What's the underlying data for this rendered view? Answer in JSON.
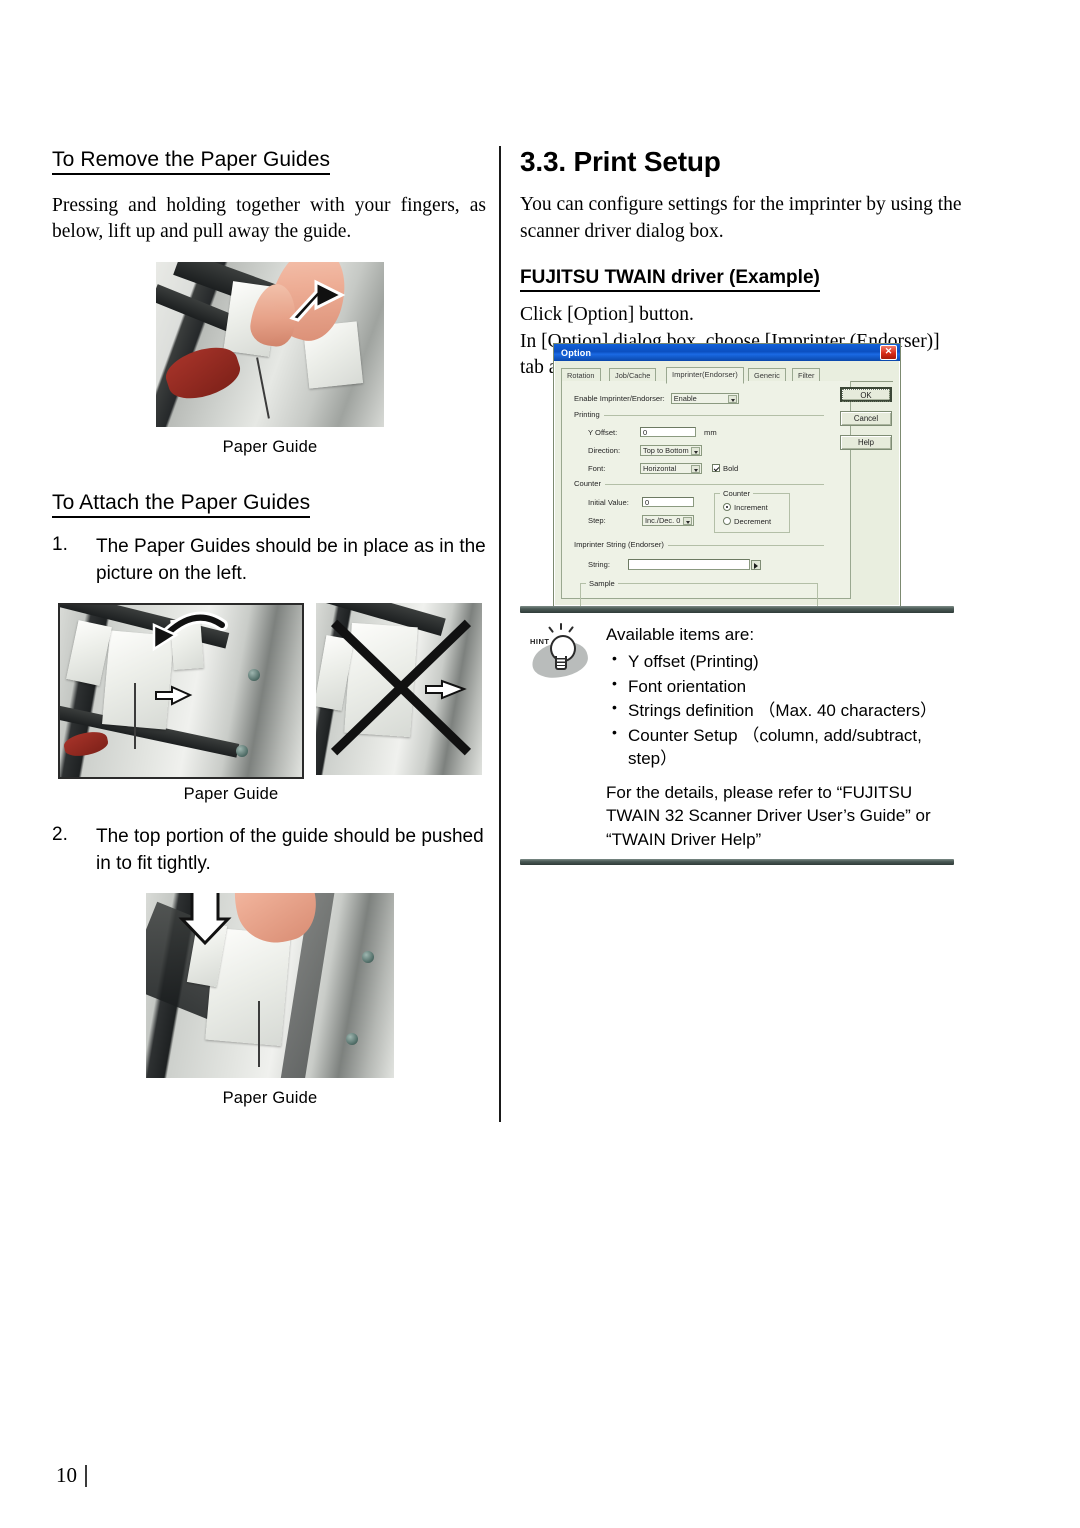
{
  "document": {
    "page_number": "10"
  },
  "left_column": {
    "remove_section": {
      "heading": "To Remove the Paper Guides",
      "body": "Pressing and holding together with your fingers, as below, lift up and pull away the guide.",
      "figure_caption": "Paper Guide"
    },
    "attach_section": {
      "heading": "To Attach the Paper Guides",
      "steps": [
        {
          "number": "1.",
          "text": "The Paper Guides should be in place as in the picture on the left."
        },
        {
          "number": "2.",
          "text": "The top portion of the guide should be pushed in to fit tightly."
        }
      ],
      "figure1_caption": "Paper Guide",
      "figure2_caption": "Paper Guide"
    }
  },
  "right_column": {
    "chapter_title": "3.3. Print Setup",
    "intro": "You can configure settings for the imprinter by using the scanner driver dialog box.",
    "subheading": "FUJITSU TWAIN driver (Example)",
    "instructions_line1": "Click [Option] button.",
    "instructions_line2": "In [Option] dialog box, choose [Imprinter (Endorser)] tab and specify the Imprinter settings."
  },
  "dialog": {
    "title": "Option",
    "close_label": "✕",
    "tabs": [
      {
        "label": "Rotation",
        "active": false
      },
      {
        "label": "Job/Cache",
        "active": false
      },
      {
        "label": "Imprinter(Endorser)",
        "active": true
      },
      {
        "label": "Generic",
        "active": false
      },
      {
        "label": "Filter",
        "active": false
      }
    ],
    "enable_label": "Enable Imprinter/Endorser:",
    "enable_value": "Enable",
    "printing_group": {
      "legend": "Printing",
      "y_offset_label": "Y Offset:",
      "y_offset_value": "0",
      "y_offset_unit": "mm",
      "direction_label": "Direction:",
      "direction_value": "Top to Bottom",
      "font_label": "Font:",
      "font_value": "Horizontal",
      "bold_label": "Bold",
      "bold_checked": true
    },
    "counter_group": {
      "legend": "Counter",
      "initial_value_label": "Initial Value:",
      "initial_value": "0",
      "step_label": "Step:",
      "step_value": "Inc./Dec. 0",
      "inner_legend": "Counter",
      "increment_label": "Increment",
      "decrement_label": "Decrement",
      "selected": "Increment"
    },
    "imprinter_string_group": {
      "legend": "Imprinter String (Endorser)",
      "string_label": "String:",
      "string_value": ""
    },
    "sample_group": {
      "legend": "Sample",
      "value": ""
    },
    "buttons": {
      "ok": "OK",
      "cancel": "Cancel",
      "help": "Help"
    },
    "colors": {
      "titlebar": "#0b4fc0",
      "face": "#eef2e6",
      "close_button": "#d82b16"
    }
  },
  "hint_box": {
    "icon_word": "HINT",
    "intro": "Available items are:",
    "items": [
      "Y offset (Printing)",
      "Font orientation",
      "Strings definition （Max. 40 characters）",
      "Counter Setup （column, add/subtract, step）"
    ],
    "footer": "For the details, please refer to “FUJITSU TWAIN 32 Scanner Driver User’s Guide” or “TWAIN Driver Help”"
  }
}
